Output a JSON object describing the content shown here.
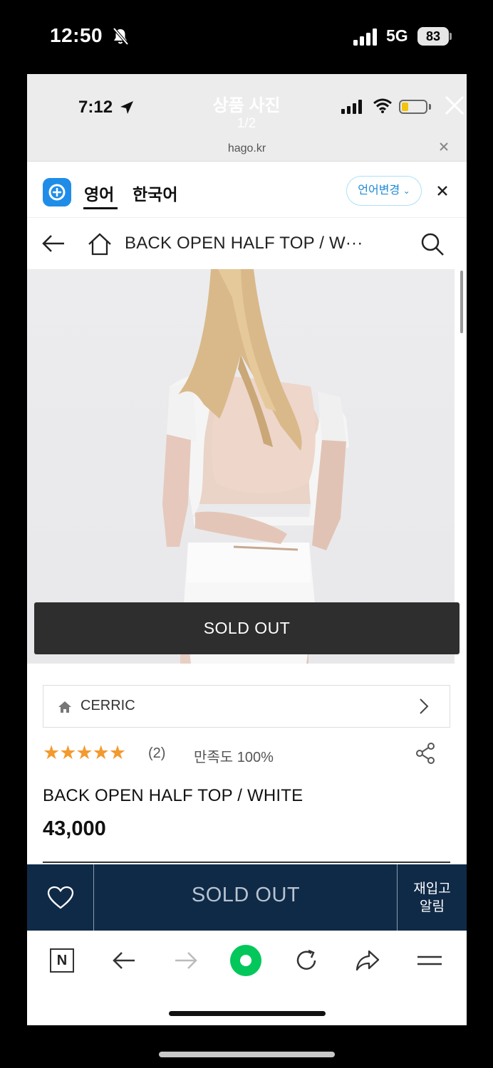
{
  "outer_status": {
    "time": "12:50",
    "network": "5G",
    "battery": "83",
    "silent_icon": "bell-slash-icon",
    "signal_icon": "cellular-signal-icon"
  },
  "viewer": {
    "title": "상품 사진",
    "counter": "1/2",
    "close_icon": "close-icon"
  },
  "inner_status": {
    "time": "7:12",
    "location_icon": "location-arrow-icon",
    "url": "hago.kr"
  },
  "translate_bar": {
    "tab_english": "영어",
    "tab_korean": "한국어",
    "change_language": "언어변경",
    "accent": "#1f8de8"
  },
  "shop_nav": {
    "title": "BACK OPEN HALF TOP / W···"
  },
  "product": {
    "sold_out_overlay": "SOLD OUT",
    "brand": "CERRIC",
    "stars": "★★★★★",
    "rating_value": 5,
    "review_count": "(2)",
    "satisfaction": "만족도 100%",
    "name": "BACK OPEN HALF TOP / WHITE",
    "price": "43,000",
    "star_color": "#f39a2e"
  },
  "purchase_bar": {
    "sold_out": "SOLD OUT",
    "restock_line1": "재입고",
    "restock_line2": "알림",
    "background": "#0f2a47"
  },
  "toolbar": {
    "naver_label": "N",
    "home_color": "#03c75a"
  }
}
